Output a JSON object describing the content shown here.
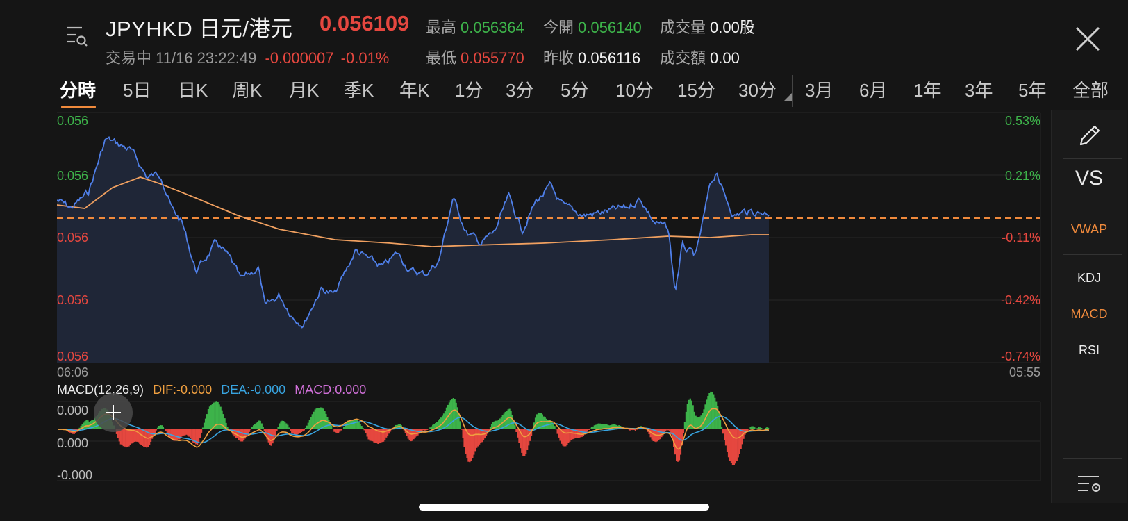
{
  "header": {
    "symbol": "JPYHKD",
    "name": "日元/港元",
    "last_price": "0.056109",
    "status": "交易中",
    "datetime": "11/16 23:22:49",
    "change": "-0.000007",
    "change_pct": "-0.01%",
    "high_label": "最高",
    "high": "0.056364",
    "open_label": "今開",
    "open": "0.056140",
    "volume_label": "成交量",
    "volume": "0.00股",
    "low_label": "最低",
    "low": "0.055770",
    "prev_close_label": "昨收",
    "prev_close": "0.056116",
    "turnover_label": "成交額",
    "turnover": "0.00"
  },
  "tabs": [
    "分時",
    "5日",
    "日K",
    "周K",
    "月K",
    "季K",
    "年K",
    "1分",
    "3分",
    "5分",
    "10分",
    "15分",
    "30分",
    "3月",
    "6月",
    "1年",
    "3年",
    "5年",
    "全部"
  ],
  "active_tab": "分時",
  "chart": {
    "left_axis": [
      "0.056",
      "0.056",
      "0.056",
      "0.056",
      "0.056"
    ],
    "right_axis": [
      "0.53%",
      "0.21%",
      "-0.11%",
      "-0.42%",
      "-0.74%"
    ],
    "time_start": "06:06",
    "time_end": "05:55"
  },
  "macd": {
    "label": "MACD(12,26,9)",
    "dif": "DIF:-0.000",
    "dea": "DEA:-0.000",
    "macd": "MACD:0.000",
    "axis": [
      "0.000",
      "0.000",
      "-0.000"
    ]
  },
  "side_panel": {
    "vs": "VS",
    "vwap": "VWAP",
    "kdj": "KDJ",
    "macd": "MACD",
    "rsi": "RSI"
  },
  "colors": {
    "price_line": "#4f7fe8",
    "avg_line": "#f0a060",
    "ref_line": "#f08a3c",
    "up": "#3db34a",
    "down": "#e5473f",
    "dif": "#f0a040",
    "dea": "#38a4e0",
    "macd_label": "#d070d8"
  }
}
